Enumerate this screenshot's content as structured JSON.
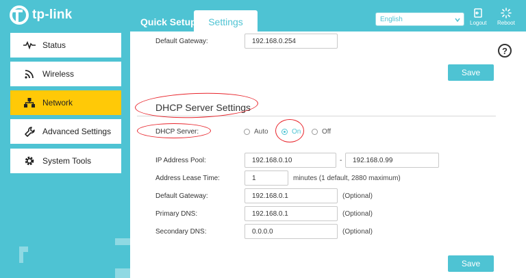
{
  "header": {
    "brand": "tp-link",
    "tabs": [
      {
        "label": "Quick Setup",
        "active": false
      },
      {
        "label": "Settings",
        "active": true
      }
    ],
    "language": "English",
    "logout_label": "Logout",
    "reboot_label": "Reboot"
  },
  "sidebar": {
    "items": [
      {
        "label": "Status",
        "icon": "pulse-icon",
        "active": false
      },
      {
        "label": "Wireless",
        "icon": "wifi-icon",
        "active": false
      },
      {
        "label": "Network",
        "icon": "network-icon",
        "active": true
      },
      {
        "label": "Advanced Settings",
        "icon": "wrench-icon",
        "active": false
      },
      {
        "label": "System Tools",
        "icon": "gear-icon",
        "active": false
      }
    ]
  },
  "main": {
    "help_icon": "?",
    "wan": {
      "gateway_label": "Default Gateway:",
      "gateway_value": "192.168.0.254",
      "save_label": "Save"
    },
    "dhcp": {
      "section_title": "DHCP Server Settings",
      "server_label": "DHCP Server:",
      "options": [
        "Auto",
        "On",
        "Off"
      ],
      "selected": "On",
      "pool_label": "IP Address Pool:",
      "pool_start": "192.168.0.10",
      "pool_separator": "-",
      "pool_end": "192.168.0.99",
      "lease_label": "Address Lease Time:",
      "lease_value": "1",
      "lease_hint": "minutes (1 default, 2880 maximum)",
      "gateway_label": "Default Gateway:",
      "gateway_value": "192.168.0.1",
      "primary_dns_label": "Primary DNS:",
      "primary_dns_value": "192.168.0.1",
      "secondary_dns_label": "Secondary DNS:",
      "secondary_dns_value": "0.0.0.0",
      "optional_hint": "(Optional)",
      "save_label": "Save"
    }
  },
  "colors": {
    "accent": "#4ec3d3",
    "active_nav": "#ffc907",
    "annotation": "#e8232a"
  }
}
